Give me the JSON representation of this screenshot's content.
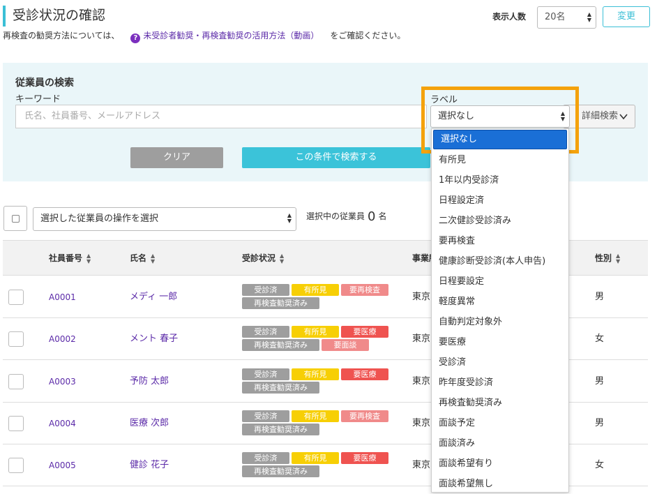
{
  "page": {
    "title": "受診状況の確認",
    "subtext_before": "再検査の勧奨方法については、",
    "help_icon_glyph": "?",
    "subtext_link": "未受診者勧奨・再検査勧奨の活用方法（動画）",
    "subtext_after": "をご確認ください。"
  },
  "display": {
    "label": "表示人数",
    "value": "20名",
    "change_button": "変更"
  },
  "search": {
    "title": "従業員の検索",
    "keyword_label": "キーワード",
    "keyword_placeholder": "氏名、社員番号、メールアドレス",
    "label_title": "ラベル",
    "label_value": "選択なし",
    "advanced_button": "詳細検索",
    "clear_button": "クリア",
    "submit_button": "この条件で検索する"
  },
  "label_options": [
    "選択なし",
    "有所見",
    "1年以内受診済",
    "日程設定済",
    "二次健診受診済み",
    "要再検査",
    "健康診断受診済(本人申告)",
    "日程要設定",
    "軽度異常",
    "自動判定対象外",
    "要医療",
    "受診済",
    "昨年度受診済",
    "再検査勧奨済み",
    "面談予定",
    "面談済み",
    "面談希望有り",
    "面談希望無し"
  ],
  "bulk": {
    "select_value": "選択した従業員の操作を選択",
    "selected_label": "選択中の従業員",
    "selected_count": "0",
    "selected_unit": "名"
  },
  "table": {
    "headers": {
      "code": "社員番号",
      "name": "氏名",
      "status": "受診状況",
      "office": "事業所",
      "sex": "性別"
    },
    "rows": [
      {
        "code": "A0001",
        "name": "メディ 一郎",
        "office": "東京",
        "sex": "男",
        "tags": [
          {
            "text": "受診済",
            "color": "#9e9e9e"
          },
          {
            "text": "有所見",
            "color": "#f7cf05"
          },
          {
            "text": "要再検査",
            "color": "#f08a8a"
          },
          {
            "text": "再検査勧奨済み",
            "color": "#9e9e9e"
          }
        ]
      },
      {
        "code": "A0002",
        "name": "メント 春子",
        "office": "東京",
        "sex": "女",
        "tags": [
          {
            "text": "受診済",
            "color": "#9e9e9e"
          },
          {
            "text": "有所見",
            "color": "#f7cf05"
          },
          {
            "text": "要医療",
            "color": "#ef5350"
          },
          {
            "text": "再検査勧奨済み",
            "color": "#9e9e9e"
          },
          {
            "text": "要面談",
            "color": "#f08a8a"
          }
        ]
      },
      {
        "code": "A0003",
        "name": "予防 太郎",
        "office": "東京",
        "sex": "男",
        "tags": [
          {
            "text": "受診済",
            "color": "#9e9e9e"
          },
          {
            "text": "有所見",
            "color": "#f7cf05"
          },
          {
            "text": "要医療",
            "color": "#ef5350"
          },
          {
            "text": "再検査勧奨済み",
            "color": "#9e9e9e"
          }
        ]
      },
      {
        "code": "A0004",
        "name": "医療 次郎",
        "office": "東京",
        "sex": "男",
        "tags": [
          {
            "text": "受診済",
            "color": "#9e9e9e"
          },
          {
            "text": "有所見",
            "color": "#f7cf05"
          },
          {
            "text": "要再検査",
            "color": "#f08a8a"
          },
          {
            "text": "再検査勧奨済み",
            "color": "#9e9e9e"
          }
        ]
      },
      {
        "code": "A0005",
        "name": "健診 花子",
        "office": "東京",
        "sex": "女",
        "tags": [
          {
            "text": "受診済",
            "color": "#9e9e9e"
          },
          {
            "text": "有所見",
            "color": "#f7cf05"
          },
          {
            "text": "要医療",
            "color": "#ef5350"
          },
          {
            "text": "再検査勧奨済み",
            "color": "#9e9e9e"
          }
        ]
      }
    ]
  },
  "colors": {
    "accent": "#3bbfd6",
    "link": "#5b2aa8",
    "highlight_border": "#f4a20c",
    "dropdown_selected": "#1a6fd6"
  }
}
